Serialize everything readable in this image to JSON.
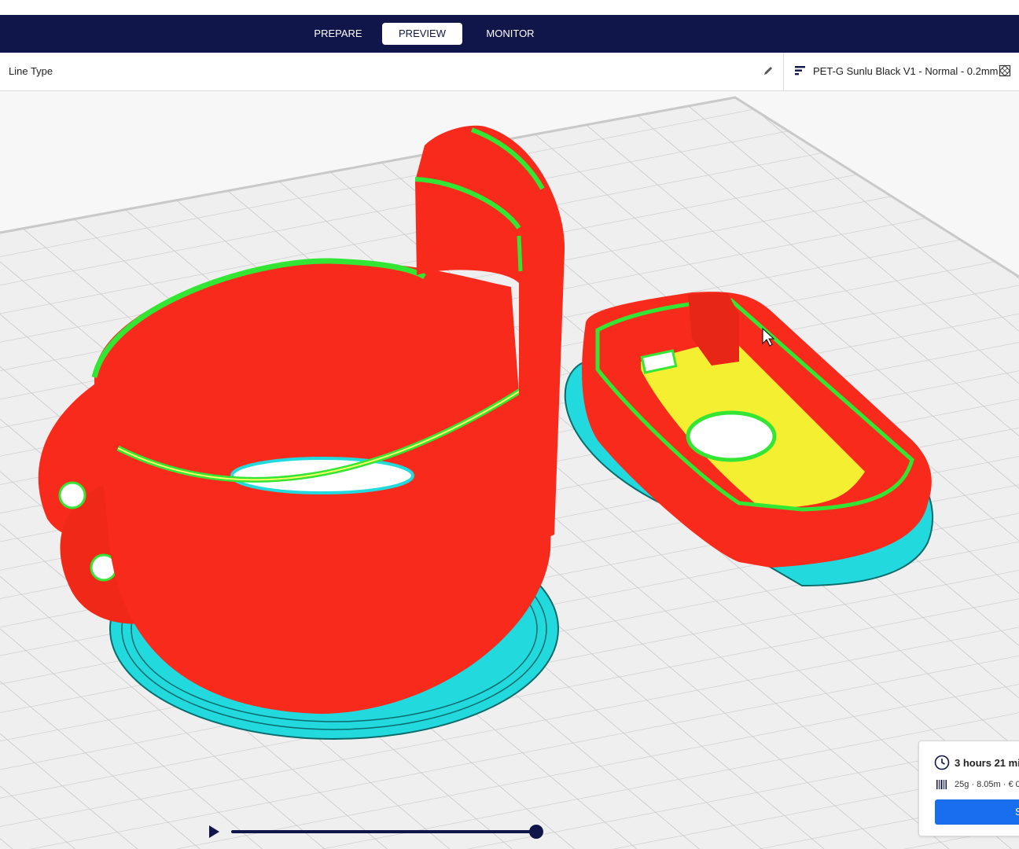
{
  "stages": {
    "prepare": "PREPARE",
    "preview": "PREVIEW",
    "monitor": "MONITOR",
    "active": "PREVIEW"
  },
  "toolbar": {
    "view_type": "Line Type",
    "profile": "PET-G Sunlu Black V1 - Normal - 0.2mm"
  },
  "icons": {
    "edit": "pencil-icon",
    "profile": "print-settings-icon",
    "support": "support-icon",
    "time": "clock-icon",
    "material": "spool-icon",
    "play": "play-icon",
    "cursor": "mouse-pointer-icon"
  },
  "estimate": {
    "time": "3 hours 21 mi",
    "material": "25g · 8.05m · € 0",
    "action_label": "Save"
  },
  "simulation": {
    "progress": 1.0
  },
  "colors": {
    "header": "#10164a",
    "wall_outer": "#ff2a1a",
    "wall_inner": "#33e633",
    "infill": "#f2f03a",
    "skirt": "#33e6e6",
    "button": "#196ef0"
  }
}
